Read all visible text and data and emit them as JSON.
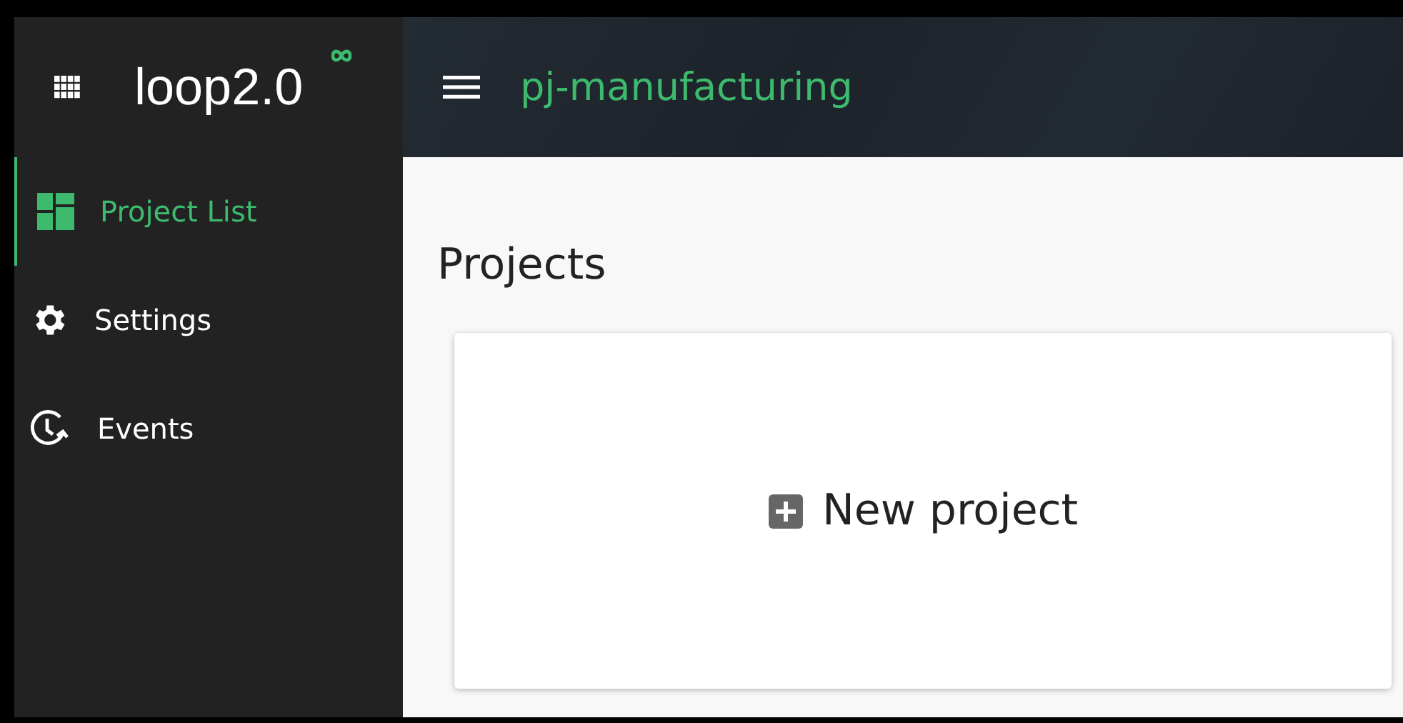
{
  "app": {
    "logo": "loop**2.0**"
  },
  "header": {
    "title": "pj-manufacturing"
  },
  "sidebar": {
    "items": [
      {
        "label": "Project List",
        "selected": true
      },
      {
        "label": "Settings",
        "selected": false
      },
      {
        "label": "Events",
        "selected": false
      }
    ]
  },
  "page": {
    "heading": "Projects",
    "new_project": "New project"
  }
}
